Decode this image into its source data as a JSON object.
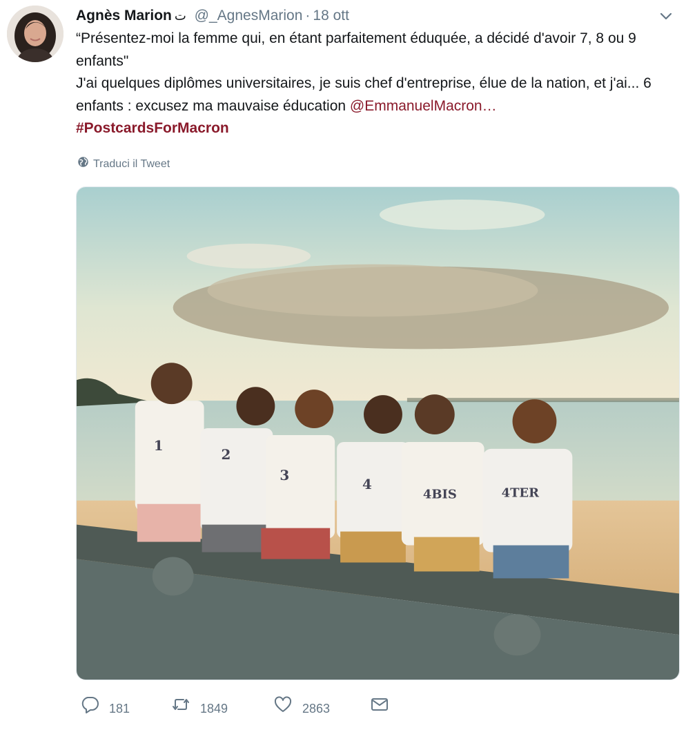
{
  "author": {
    "name": "Agnès Marion",
    "emoji": "ت",
    "handle": "@_AgnesMarion",
    "separator": "·",
    "date": "18 ott"
  },
  "tweet": {
    "line1": "“Présentez-moi la femme qui, en étant parfaitement éduquée, a décidé d'avoir 7, 8 ou 9 enfants\"",
    "line2_text": "J'ai quelques diplômes universitaires, je suis chef d'entreprise, élue de la nation, et j'ai... 6 enfants : excusez ma mauvaise éducation ",
    "mention": "@EmmanuelMacron…",
    "hashtag": "#PostcardsForMacron"
  },
  "translate_label": "Traduci il Tweet",
  "photo_shirts": [
    "1",
    "2",
    "3",
    "4",
    "4BIS",
    "4TER"
  ],
  "stats": {
    "replies": "181",
    "retweets": "1849",
    "likes": "2863"
  },
  "icons": {
    "caret": "chevron-down-icon",
    "globe": "globe-icon",
    "reply": "reply-icon",
    "retweet": "retweet-icon",
    "like": "heart-icon",
    "dm": "envelope-icon"
  },
  "colors": {
    "link": "#8a1a2b",
    "muted": "#657786",
    "text": "#14171a"
  }
}
